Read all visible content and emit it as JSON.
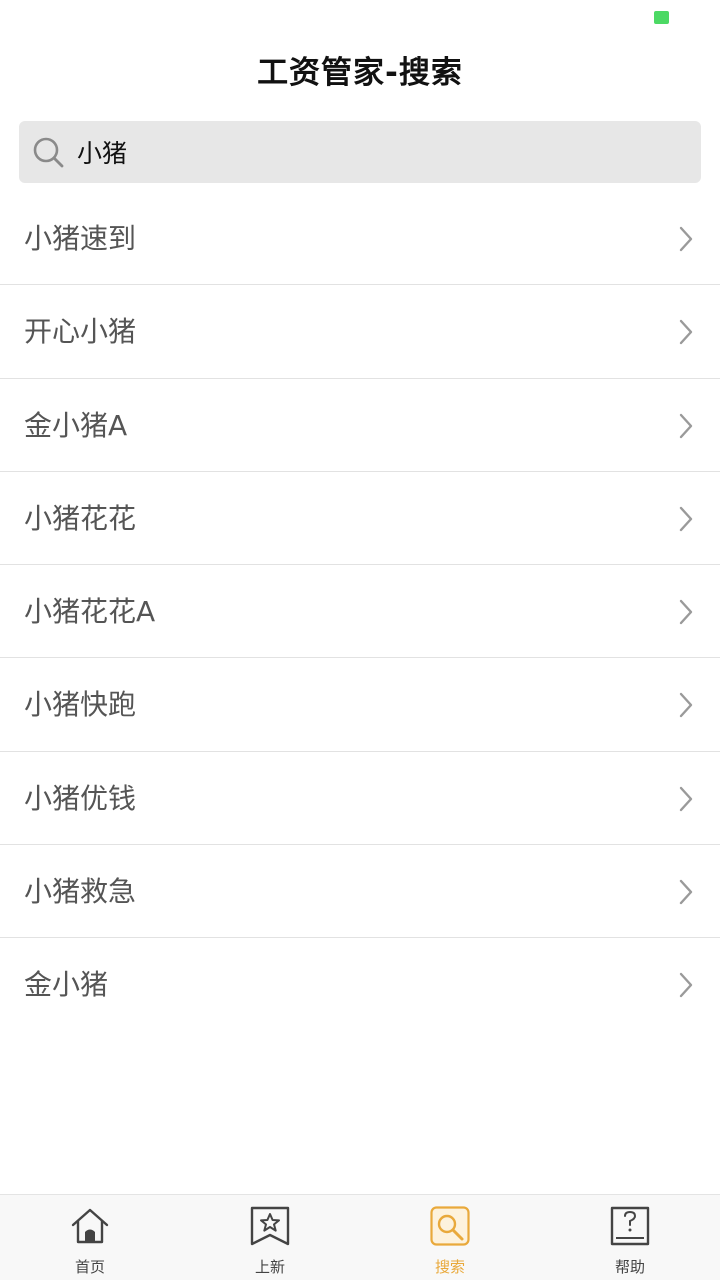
{
  "status_bar": {
    "battery_color": "#4cd964"
  },
  "header": {
    "title": "工资管家-搜索"
  },
  "search": {
    "value": "小猪",
    "icon": "search-icon"
  },
  "results": [
    {
      "label": "小猪速到"
    },
    {
      "label": "开心小猪"
    },
    {
      "label": "金小猪A"
    },
    {
      "label": "小猪花花"
    },
    {
      "label": "小猪花花A"
    },
    {
      "label": "小猪快跑"
    },
    {
      "label": "小猪优钱"
    },
    {
      "label": "小猪救急"
    },
    {
      "label": "金小猪"
    }
  ],
  "tabs": [
    {
      "label": "首页",
      "icon": "home-icon",
      "active": false
    },
    {
      "label": "上新",
      "icon": "star-bookmark-icon",
      "active": false
    },
    {
      "label": "搜索",
      "icon": "search-icon",
      "active": true
    },
    {
      "label": "帮助",
      "icon": "help-book-icon",
      "active": false
    }
  ],
  "colors": {
    "accent": "#e9a93b",
    "text": "#555555",
    "divider": "#e2e2e2",
    "search_bg": "#e7e7e7"
  }
}
